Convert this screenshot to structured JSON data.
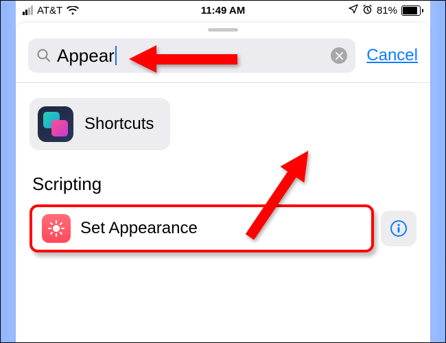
{
  "status": {
    "carrier": "AT&T",
    "time": "11:49 AM",
    "battery_pct": "81%",
    "battery_fill_pct": 81
  },
  "search": {
    "value": "Appear",
    "cancel_label": "Cancel"
  },
  "suggestion_pill": {
    "label": "Shortcuts"
  },
  "section": {
    "title": "Scripting"
  },
  "action": {
    "label": "Set Appearance"
  },
  "icons": {
    "search": "search-icon",
    "clear": "clear-icon",
    "location": "location-icon",
    "alarm": "alarm-icon",
    "brightness": "brightness-icon",
    "info": "info-icon",
    "wifi": "wifi-icon",
    "shortcuts_app": "shortcuts-app-icon"
  },
  "colors": {
    "accent_blue": "#0a7cff",
    "annotation_red": "#ff0000",
    "action_icon_bg": "#ff5866"
  }
}
